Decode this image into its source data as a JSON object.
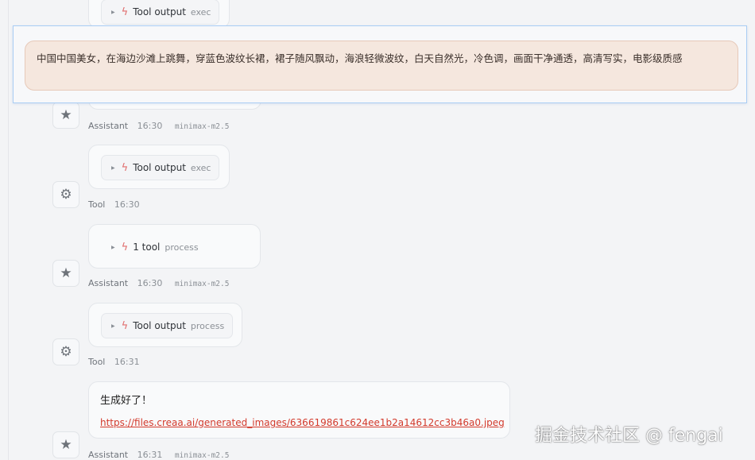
{
  "prompt_popup": {
    "text": "中国中国美女，在海边沙滩上跳舞，穿蓝色波纹长裙，裙子随风飘动，海浪轻微波纹，白天自然光，冷色调，画面干净通透，高清写实，电影级质感"
  },
  "messages": [
    {
      "role": "Assistant",
      "time": "16:30",
      "model": "minimax-m2.5",
      "avatar": "star-icon"
    },
    {
      "role": "Tool",
      "time": "16:30",
      "avatar": "gear-icon",
      "chip": {
        "title": "Tool output",
        "subtitle": "exec"
      }
    },
    {
      "role": "Assistant",
      "time": "16:30",
      "model": "minimax-m2.5",
      "avatar": "star-icon",
      "chip": {
        "title": "1 tool",
        "subtitle": "process"
      }
    },
    {
      "role": "Tool",
      "time": "16:31",
      "avatar": "gear-icon",
      "chip": {
        "title": "Tool output",
        "subtitle": "process"
      }
    },
    {
      "role": "Assistant",
      "time": "16:31",
      "model": "minimax-m2.5",
      "avatar": "star-icon",
      "text": "生成好了！",
      "link": "https://files.creaa.ai/generated_images/636619861c624ee1b2a14612cc3b46a0.jpeg"
    }
  ],
  "top_partial_chip": {
    "title": "Tool output",
    "subtitle": "exec"
  },
  "watermark": "掘金技术社区 @ fengai",
  "colors": {
    "accent_link": "#d33a2c",
    "bolt": "#e06c6c",
    "popup_border": "#a9cdf4",
    "prompt_bg": "#f5e7de"
  }
}
